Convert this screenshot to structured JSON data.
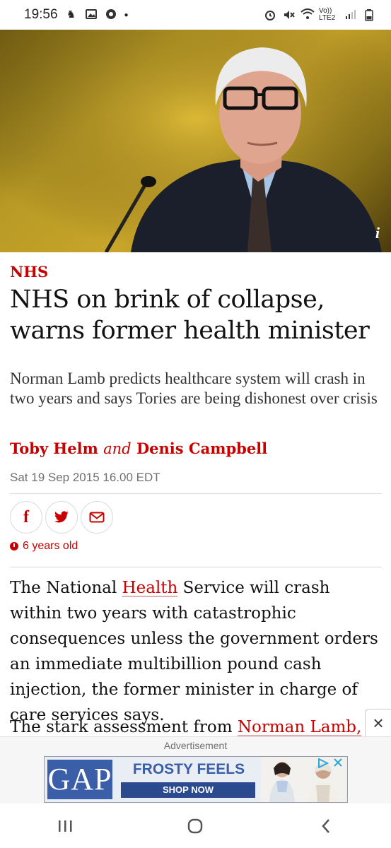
{
  "status_bar": {
    "time": "19:56",
    "network_label": "Vo)) LTE2"
  },
  "article": {
    "kicker": "NHS",
    "headline": "NHS on brink of collapse, warns former health minister",
    "standfirst": "Norman Lamb predicts healthcare system will crash in two years and says Tories are being dishonest over crisis",
    "author1": "Toby Helm",
    "and": "and",
    "author2": "Denis Campbell",
    "dateline": "Sat 19 Sep 2015 16.00 EDT",
    "age": "6 years old",
    "image_info_label": "i",
    "body1_a": "The National ",
    "body1_link": "Health",
    "body1_b": " Service will crash within two years with catastrophic consequences unless the government orders an immediate multibillion pound cash injection, the former minister in charge of care services says.",
    "body2_a": "The stark assessment from ",
    "body2_link": "Norman Lamb,"
  },
  "share": {
    "facebook_glyph": "f"
  },
  "ad": {
    "label": "Advertisement",
    "brand": "GAP",
    "headline": "FROSTY FEELS",
    "cta": "SHOP NOW",
    "close_glyph": "×"
  },
  "colors": {
    "accent": "#c70000",
    "ad_blue": "#3a5ea8"
  }
}
